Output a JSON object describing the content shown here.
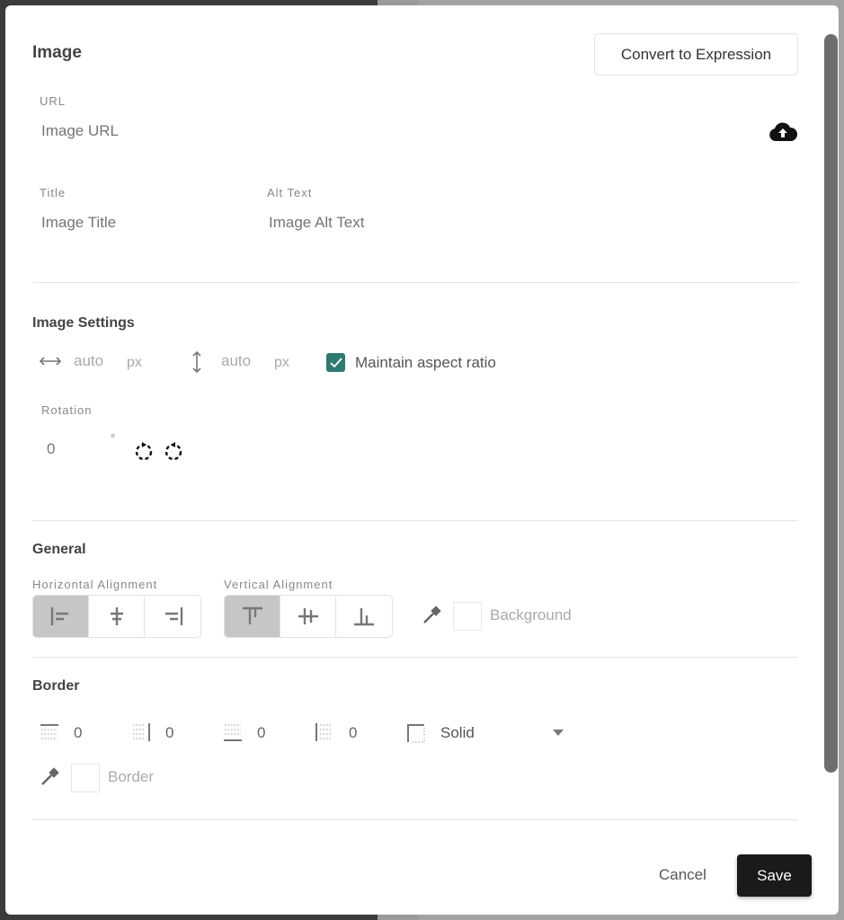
{
  "dialog": {
    "title": "Image",
    "convert_label": "Convert to Expression"
  },
  "url": {
    "label": "URL",
    "placeholder": "Image URL"
  },
  "title_field": {
    "label": "Title",
    "placeholder": "Image Title"
  },
  "alt_field": {
    "label": "Alt Text",
    "placeholder": "Image Alt Text"
  },
  "image_settings": {
    "heading": "Image Settings",
    "width": "auto",
    "height": "auto",
    "unit": "px",
    "maintain_label": "Maintain aspect ratio",
    "maintain_checked": true,
    "rotation_label": "Rotation",
    "rotation_value": "0",
    "degree": "°"
  },
  "general": {
    "heading": "General",
    "h_align_label": "Horizontal Alignment",
    "v_align_label": "Vertical Alignment",
    "h_align_selected": "left",
    "v_align_selected": "top",
    "background_label": "Background"
  },
  "border": {
    "heading": "Border",
    "top": "0",
    "right": "0",
    "bottom": "0",
    "left": "0",
    "style": "Solid",
    "color_label": "Border"
  },
  "footer": {
    "cancel": "Cancel",
    "save": "Save"
  },
  "colors": {
    "checkbox": "#2f7a6e",
    "save_bg": "#1a1a1a"
  }
}
